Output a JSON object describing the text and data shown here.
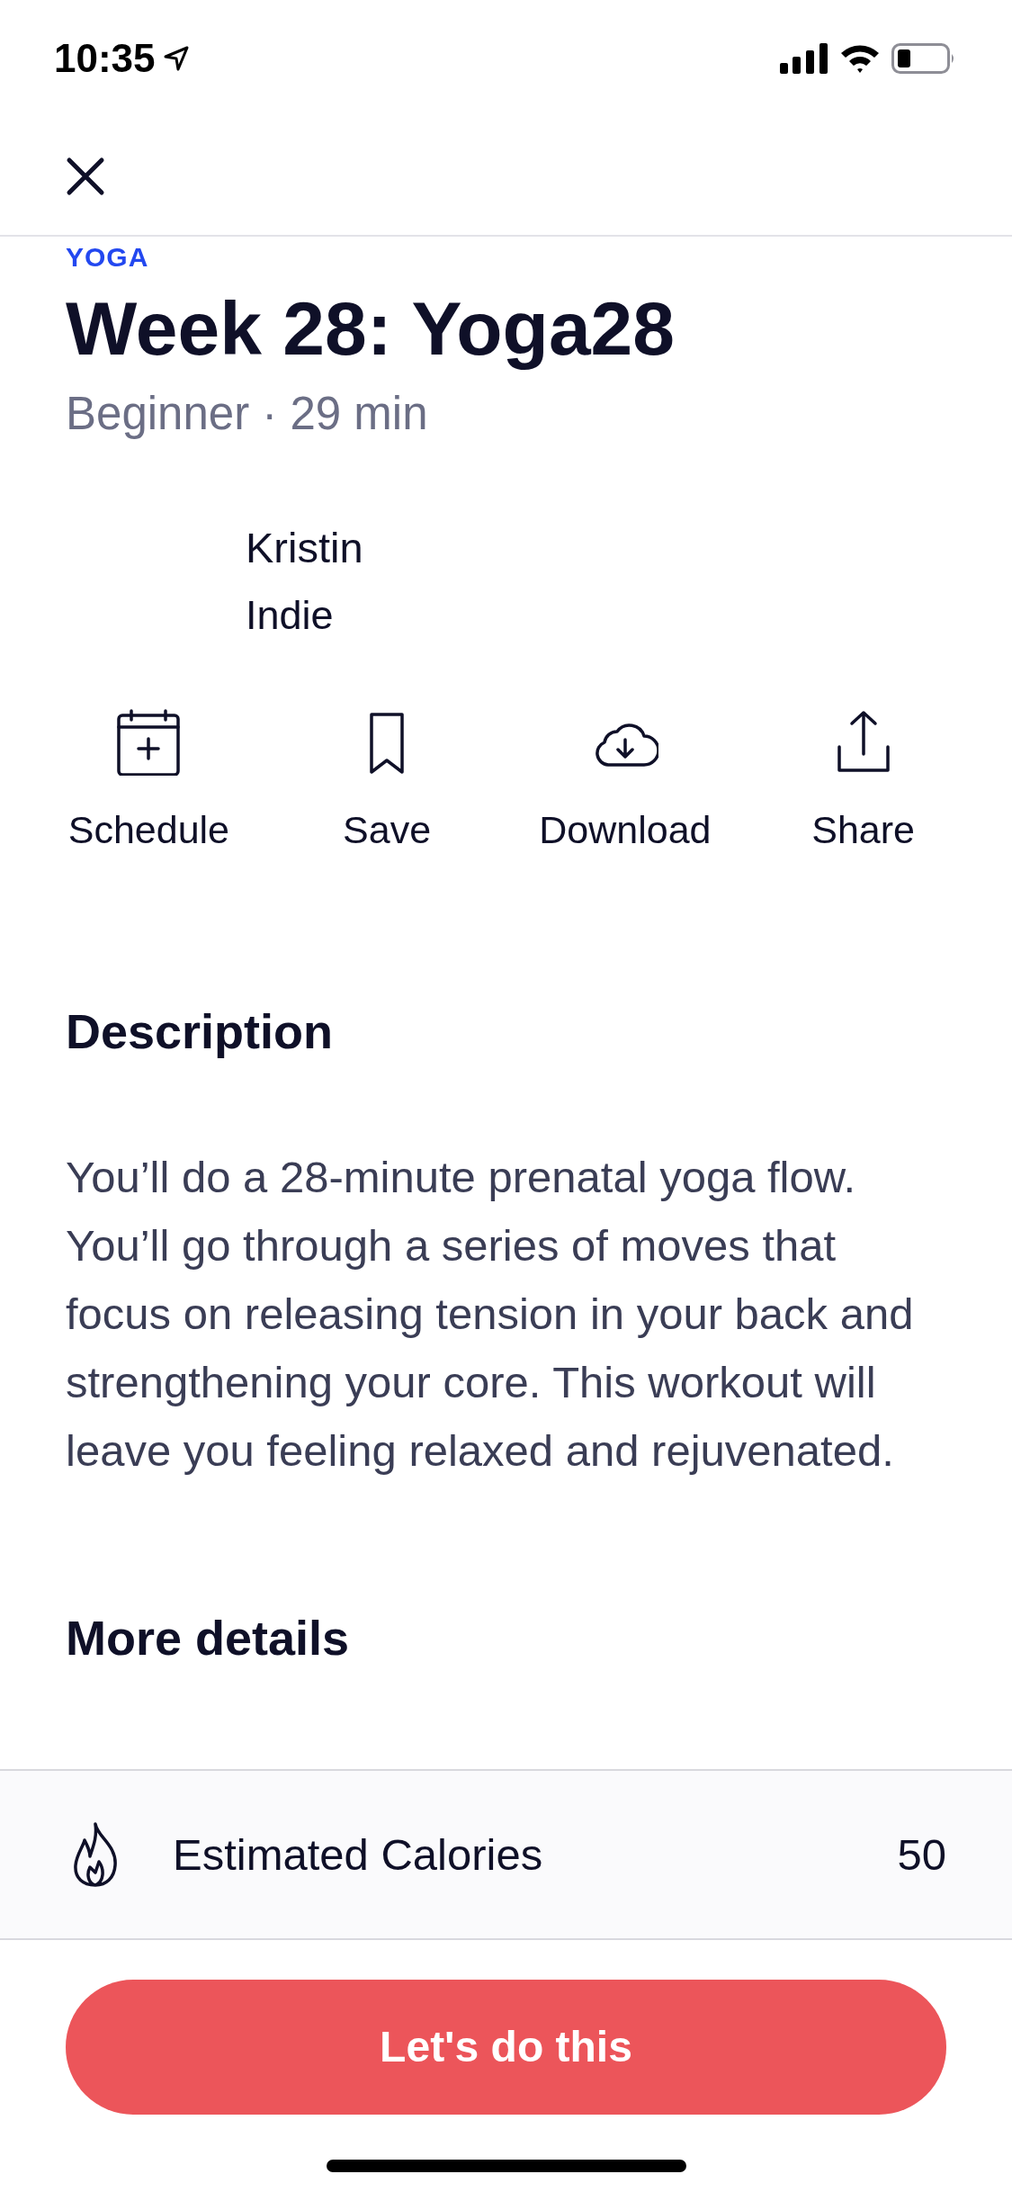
{
  "status_bar": {
    "time": "10:35"
  },
  "category": "YOGA",
  "title": "Week 28: Yoga28",
  "subtitle": "Beginner · 29 min",
  "trainer": {
    "name": "Kristin",
    "team": "Indie"
  },
  "actions": [
    {
      "kind": "schedule",
      "label": "Schedule"
    },
    {
      "kind": "save",
      "label": "Save"
    },
    {
      "kind": "download",
      "label": "Download"
    },
    {
      "kind": "share",
      "label": "Share"
    }
  ],
  "description": {
    "heading": "Description",
    "text": "You’ll do a 28-minute prenatal yoga flow. You’ll go through a series of moves that focus on releasing tension in your back and strengthening your core. This workout will leave you feeling relaxed and rejuvenated."
  },
  "more_details": {
    "heading": "More details",
    "rows": [
      {
        "kind": "calories",
        "label": "Estimated Calories",
        "value": "50"
      }
    ]
  },
  "primary_button": "Let's do this"
}
